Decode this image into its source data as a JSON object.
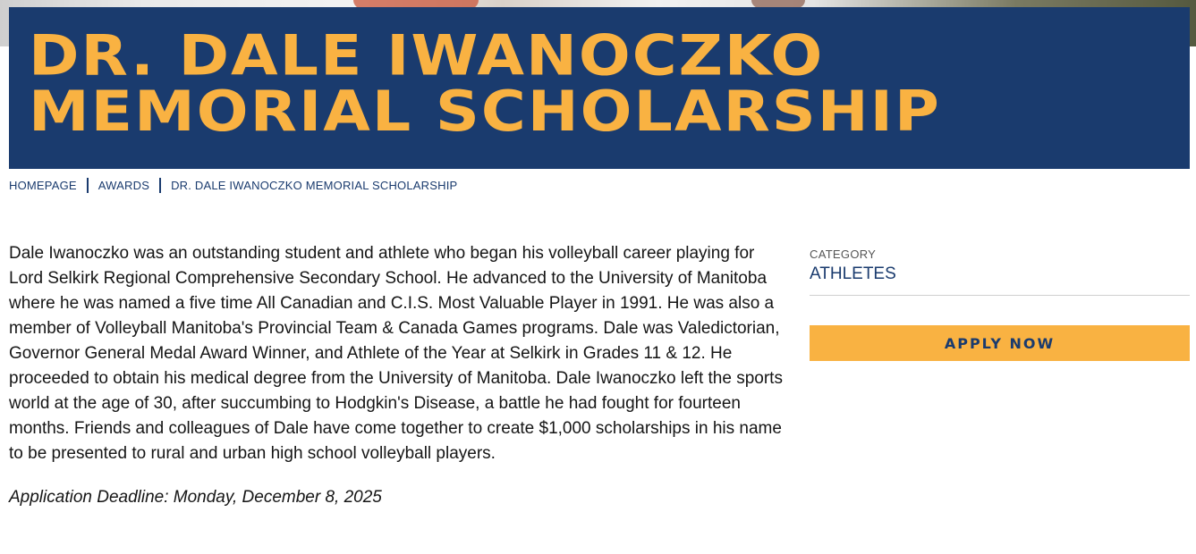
{
  "banner": {
    "title": "Dr. Dale Iwanoczko Memorial Scholarship"
  },
  "breadcrumb": {
    "items": [
      "HOMEPAGE",
      "AWARDS",
      "DR. DALE IWANOCZKO MEMORIAL SCHOLARSHIP"
    ]
  },
  "content": {
    "body": "Dale Iwanoczko was an outstanding student and athlete who began his volleyball career playing for Lord Selkirk Regional Comprehensive Secondary School. He advanced to the University of Manitoba where he was named a five time All Canadian and C.I.S. Most Valuable Player in 1991. He was also a member of Volleyball Manitoba's Provincial Team & Canada Games programs. Dale was Valedictorian, Governor General Medal Award Winner, and Athlete of the Year at Selkirk in Grades 11 & 12. He proceeded to obtain his medical degree from the University of Manitoba. Dale Iwanoczko left the sports world at the age of 30, after succumbing to Hodgkin's Disease, a battle he had fought for fourteen months. Friends and colleagues of Dale have come together to create $1,000 scholarships in his name to be presented to rural and urban high school volleyball players.",
    "deadline": "Application Deadline: Monday, December 8, 2025"
  },
  "sidebar": {
    "category_label": "CATEGORY",
    "category_value": "ATHLETES",
    "apply_label": "APPLY NOW"
  },
  "colors": {
    "navy": "#1a3b6e",
    "gold": "#f9b242"
  }
}
